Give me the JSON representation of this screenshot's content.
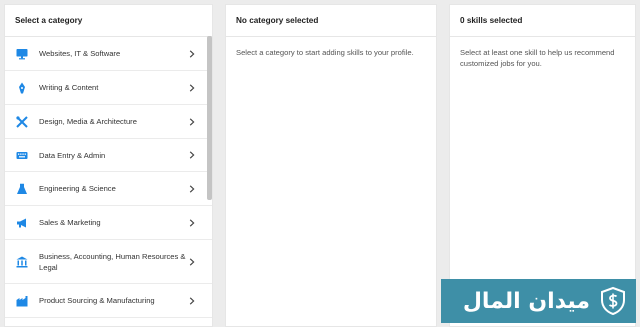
{
  "categories_panel": {
    "header": "Select a category",
    "items": [
      {
        "label": "Websites, IT & Software",
        "icon": "monitor-icon"
      },
      {
        "label": "Writing & Content",
        "icon": "pen-nib-icon"
      },
      {
        "label": "Design, Media & Architecture",
        "icon": "design-tools-icon"
      },
      {
        "label": "Data Entry & Admin",
        "icon": "keyboard-icon"
      },
      {
        "label": "Engineering & Science",
        "icon": "flask-icon"
      },
      {
        "label": "Sales & Marketing",
        "icon": "megaphone-icon"
      },
      {
        "label": "Business, Accounting, Human Resources & Legal",
        "icon": "bank-icon"
      },
      {
        "label": "Product Sourcing & Manufacturing",
        "icon": "factory-icon"
      }
    ]
  },
  "skills_panel": {
    "header": "No category selected",
    "body": "Select a category to start adding skills to your profile."
  },
  "selected_panel": {
    "header": "0 skills selected",
    "body": "Select at least one skill to help us recommend customized jobs for you."
  },
  "watermark": {
    "text": "ميدان المال",
    "logo": "dollar-shield-logo"
  },
  "colors": {
    "icon_blue": "#1e88e5",
    "watermark_bg": "#3e8fa7"
  }
}
